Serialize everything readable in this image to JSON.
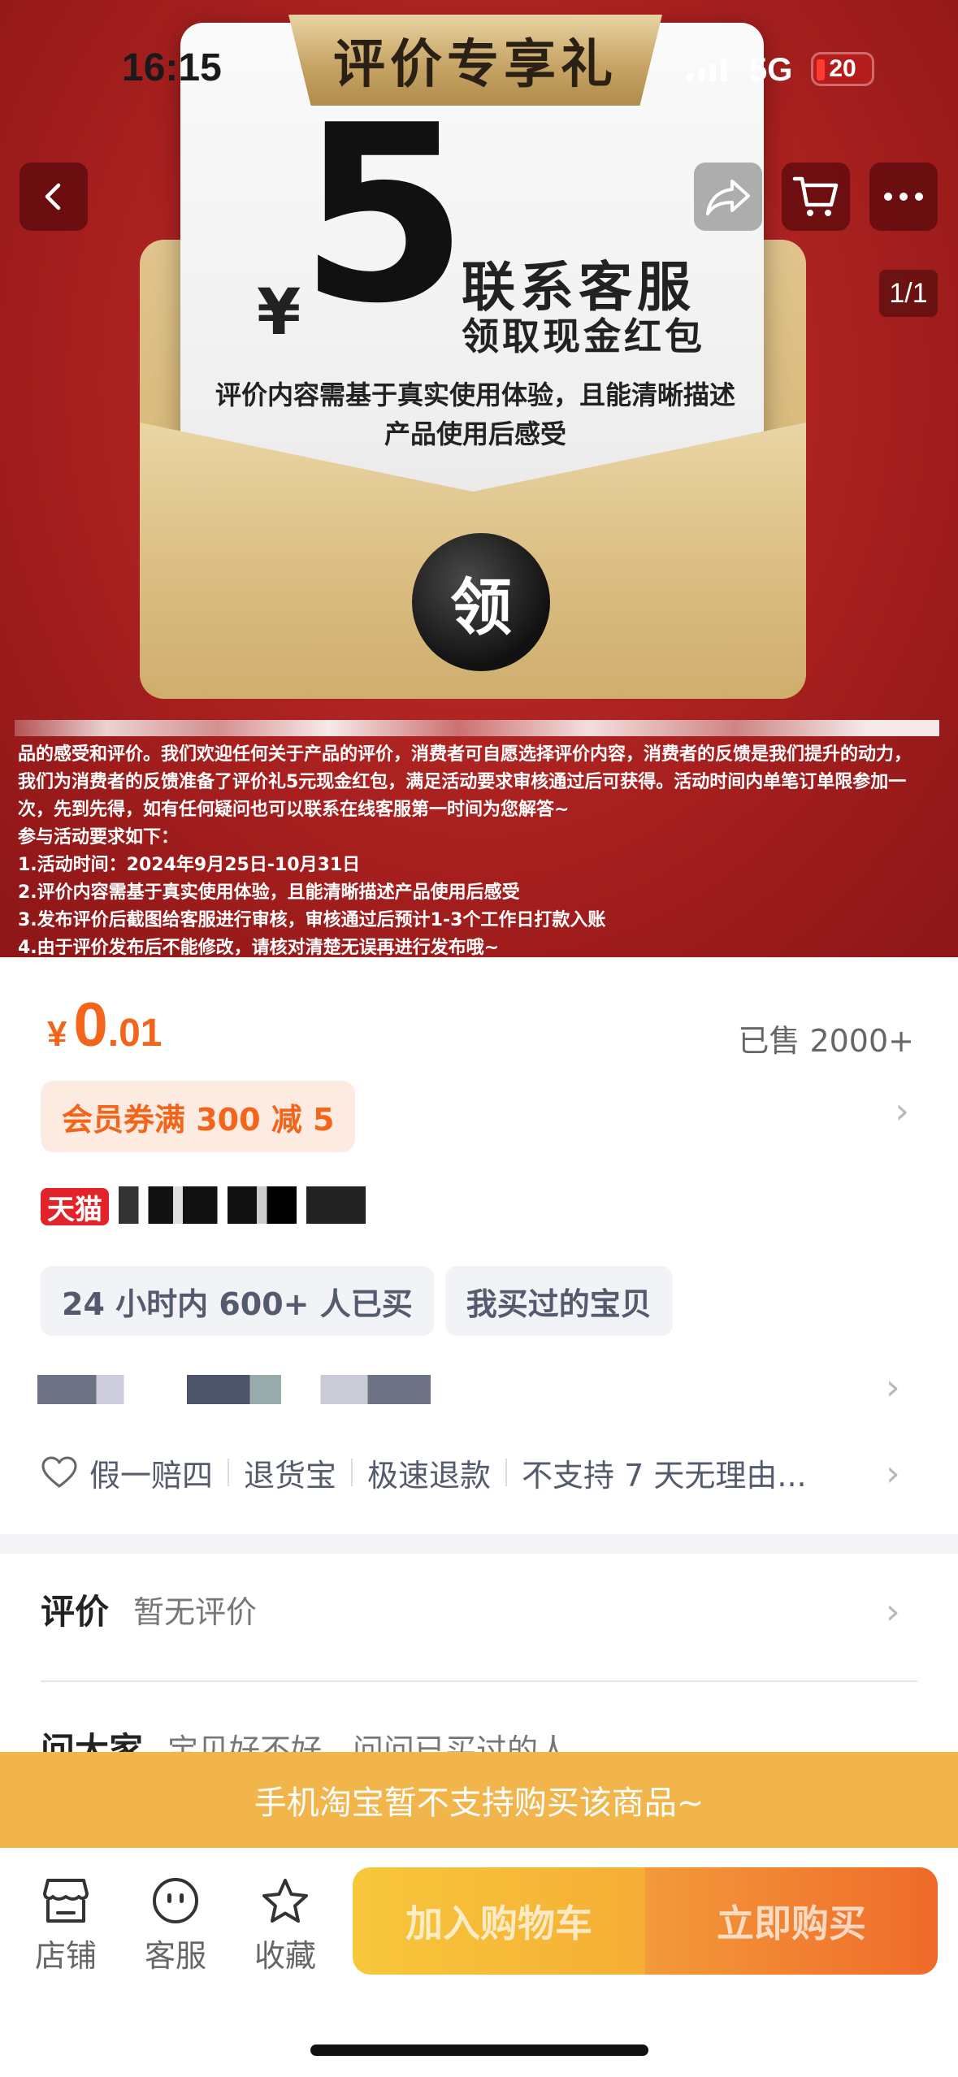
{
  "status_bar": {
    "time": "16:15",
    "network": "5G",
    "battery": "20"
  },
  "nav": {
    "pager": "1/1"
  },
  "poster": {
    "ribbon": "评价专享礼",
    "big_number": "5",
    "currency": "¥",
    "contact": "联系客服",
    "redpack": "领取现金红包",
    "desc_line1": "评价内容需基于真实使用体验，且能清晰描述",
    "desc_line2": "产品使用后感受",
    "seal": "领",
    "rules": [
      "品的感受和评价。我们欢迎任何关于产品的评价，消费者可自愿选择评价内容，消费者的反馈是我们提升的动力，",
      "我们为消费者的反馈准备了评价礼5元现金红包，满足活动要求审核通过后可获得。活动时间内单笔订单限参加一",
      "次，先到先得，如有任何疑问也可以联系在线客服第一时间为您解答~",
      "参与活动要求如下：",
      "1.活动时间：2024年9月25日-10月31日",
      "2.评价内容需基于真实使用体验，且能清晰描述产品使用后感受",
      "3.发布评价后截图给客服进行审核，审核通过后预计1-3个工作日打款入账",
      "4.由于评价发布后不能修改，请核对清楚无误再进行发布哦~"
    ]
  },
  "price": {
    "currency": "¥",
    "integer": "0",
    "decimal": ".01",
    "sold": "已售 2000+"
  },
  "coupon": "会员券满 300 减 5",
  "tmall_badge": "天猫",
  "pills": [
    "24 小时内 600+ 人已买",
    "我买过的宝贝"
  ],
  "services": [
    "假一赔四",
    "退货宝",
    "极速退款",
    "不支持 7 天无理由..."
  ],
  "eval": {
    "label": "评价",
    "value": "暂无评价"
  },
  "ask": {
    "label": "问大家",
    "value": "宝贝好不好，问问已买过的人"
  },
  "banner": "手机淘宝暂不支持购买该商品~",
  "tabbar": {
    "shop": "店铺",
    "service": "客服",
    "favorite": "收藏",
    "add_cart": "加入购物车",
    "buy_now": "立即购买"
  },
  "colors": {
    "accent": "#f2651a",
    "banner": "#f2b54b",
    "tmall": "#e2232a",
    "hero_red": "#a8201f"
  }
}
